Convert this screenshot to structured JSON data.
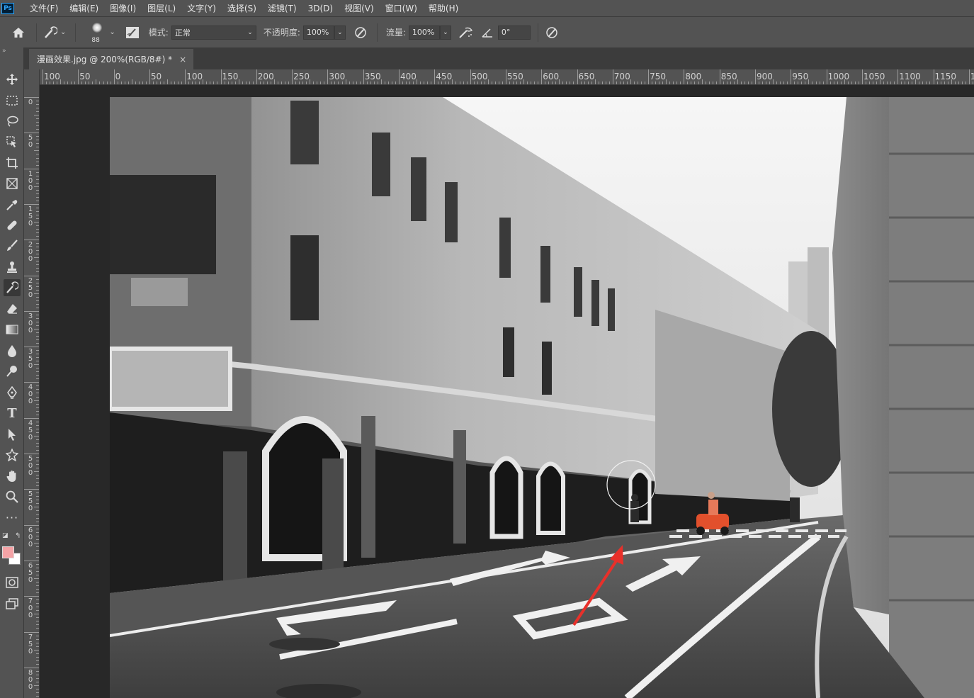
{
  "app": {
    "logo": "Ps"
  },
  "menu": [
    "文件(F)",
    "编辑(E)",
    "图像(I)",
    "图层(L)",
    "文字(Y)",
    "选择(S)",
    "滤镜(T)",
    "3D(D)",
    "视图(V)",
    "窗口(W)",
    "帮助(H)"
  ],
  "options": {
    "brush_size": "88",
    "mode_label": "模式:",
    "mode_value": "正常",
    "opacity_label": "不透明度:",
    "opacity_value": "100%",
    "flow_label": "流量:",
    "flow_value": "100%",
    "angle_value": "0°"
  },
  "document": {
    "tab_title": "漫画效果.jpg @ 200%(RGB/8#) *",
    "close_glyph": "×"
  },
  "ruler": {
    "h_labels": [
      "100",
      "50",
      "0",
      "50",
      "100",
      "150",
      "200",
      "250",
      "300",
      "350",
      "400",
      "450",
      "500",
      "550",
      "600",
      "650",
      "700",
      "750",
      "800",
      "850",
      "900",
      "950",
      "1000",
      "1050",
      "1100",
      "1150",
      "12"
    ],
    "v_labels": [
      "0",
      "50",
      "100",
      "150",
      "200",
      "250",
      "300",
      "350",
      "400",
      "450",
      "500",
      "550",
      "600",
      "650",
      "700",
      "750",
      "800"
    ]
  },
  "colors": {
    "foreground": "#f4a3a6",
    "background": "#ffffff",
    "annotation_arrow": "#e8302a",
    "scooter": "#e2502c"
  },
  "tools": [
    "move-icon",
    "marquee-icon",
    "lasso-icon",
    "object-select-icon",
    "crop-icon",
    "frame-icon",
    "eyedropper-icon",
    "healing-icon",
    "brush-icon",
    "stamp-icon",
    "history-brush-icon",
    "eraser-icon",
    "gradient-icon",
    "blur-icon",
    "dodge-icon",
    "pen-icon",
    "type-icon",
    "path-select-icon",
    "shape-icon",
    "hand-icon",
    "zoom-icon",
    "more-icon",
    "quick-mask-icon",
    "screen-mode-icon"
  ]
}
